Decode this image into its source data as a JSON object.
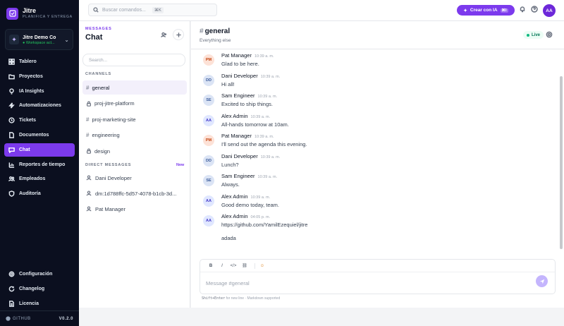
{
  "brand": {
    "name": "Jitre",
    "tagline": "PLANIFICA Y ENTREGA"
  },
  "workspace": {
    "name": "Jitre Demo Co",
    "status": "● Workspace act..."
  },
  "nav": {
    "items": [
      {
        "label": "Tablero",
        "icon": "grid-icon"
      },
      {
        "label": "Proyectos",
        "icon": "folder-icon"
      },
      {
        "label": "IA Insights",
        "icon": "lightbulb-icon"
      },
      {
        "label": "Automatizaciones",
        "icon": "bolt-icon"
      },
      {
        "label": "Tickets",
        "icon": "ticket-icon"
      },
      {
        "label": "Documentos",
        "icon": "document-icon"
      },
      {
        "label": "Chat",
        "icon": "chat-icon",
        "active": true
      },
      {
        "label": "Reportes de tiempo",
        "icon": "chart-icon"
      },
      {
        "label": "Empleados",
        "icon": "users-icon"
      },
      {
        "label": "Auditoría",
        "icon": "shield-icon"
      }
    ],
    "bottom": [
      {
        "label": "Configuración",
        "icon": "gear-icon"
      },
      {
        "label": "Changelog",
        "icon": "refresh-icon"
      },
      {
        "label": "Licencia",
        "icon": "license-icon"
      }
    ]
  },
  "footer": {
    "github": "GITHUB",
    "version": "V0.2.0"
  },
  "topbar": {
    "search_placeholder": "Buscar comandos...",
    "search_shortcut": "⌘K",
    "create_label": "Crear con IA",
    "create_shortcut": "⌘I",
    "avatar": "AA"
  },
  "channels_panel": {
    "caption": "MESSAGES",
    "title": "Chat",
    "search_placeholder": "Search...",
    "channels_label": "CHANNELS",
    "channels": [
      {
        "name": "general",
        "type": "public",
        "active": true
      },
      {
        "name": "proj-jitre-platform",
        "type": "private"
      },
      {
        "name": "proj-marketing-site",
        "type": "public"
      },
      {
        "name": "engineering",
        "type": "public"
      },
      {
        "name": "design",
        "type": "private"
      }
    ],
    "dm_label": "DIRECT MESSAGES",
    "dm_new": "New",
    "dms": [
      {
        "name": "Dani Developer"
      },
      {
        "name": "dm:1d788ffc-5d57-4078-b1cb-3d..."
      },
      {
        "name": "Pat Manager"
      }
    ]
  },
  "chat": {
    "channel_hash": "#",
    "channel": "general",
    "subtitle": "Everything else",
    "live": "Live",
    "messages": [
      {
        "initials": "PM",
        "author": "Pat Manager",
        "time": "10:39 a. m.",
        "text": "Glad to be here.",
        "color": "pm"
      },
      {
        "initials": "DD",
        "author": "Dani Developer",
        "time": "10:39 a. m.",
        "text": "Hi all!",
        "color": "dd"
      },
      {
        "initials": "SE",
        "author": "Sam Engineer",
        "time": "10:39 a. m.",
        "text": "Excited to ship things.",
        "color": "se"
      },
      {
        "initials": "AA",
        "author": "Alex Admin",
        "time": "10:39 a. m.",
        "text": "All-hands tomorrow at 10am.",
        "color": "aa"
      },
      {
        "initials": "PM",
        "author": "Pat Manager",
        "time": "10:39 a. m.",
        "text": "I'll send out the agenda this evening.",
        "color": "pm"
      },
      {
        "initials": "DD",
        "author": "Dani Developer",
        "time": "10:39 a. m.",
        "text": "Lunch?",
        "color": "dd"
      },
      {
        "initials": "SE",
        "author": "Sam Engineer",
        "time": "10:39 a. m.",
        "text": "Always.",
        "color": "se"
      },
      {
        "initials": "AA",
        "author": "Alex Admin",
        "time": "10:39 a. m.",
        "text": "Good demo today, team.",
        "color": "aa"
      },
      {
        "initials": "AA",
        "author": "Alex Admin",
        "time": "04:05 p. m.",
        "text": "https://github.com/YamilEzequiel/jitre",
        "color": "aa"
      }
    ],
    "continuation": "adada",
    "toolbar": {
      "bold": "B",
      "italic": "I",
      "code": "</>",
      "link": "⛓",
      "emoji": "☺"
    },
    "composer_placeholder": "Message #general",
    "hint_key": "Shift+Enter",
    "hint_text": "for new line · Markdown supported"
  },
  "avatar_colors": {
    "pm": {
      "bg": "#fde2d7",
      "fg": "#c2410c"
    },
    "dd": {
      "bg": "#dbe4f5",
      "fg": "#3b5b9a"
    },
    "se": {
      "bg": "#dbe4f5",
      "fg": "#3b5b9a"
    },
    "aa": {
      "bg": "#e0e7ff",
      "fg": "#4338ca"
    }
  }
}
